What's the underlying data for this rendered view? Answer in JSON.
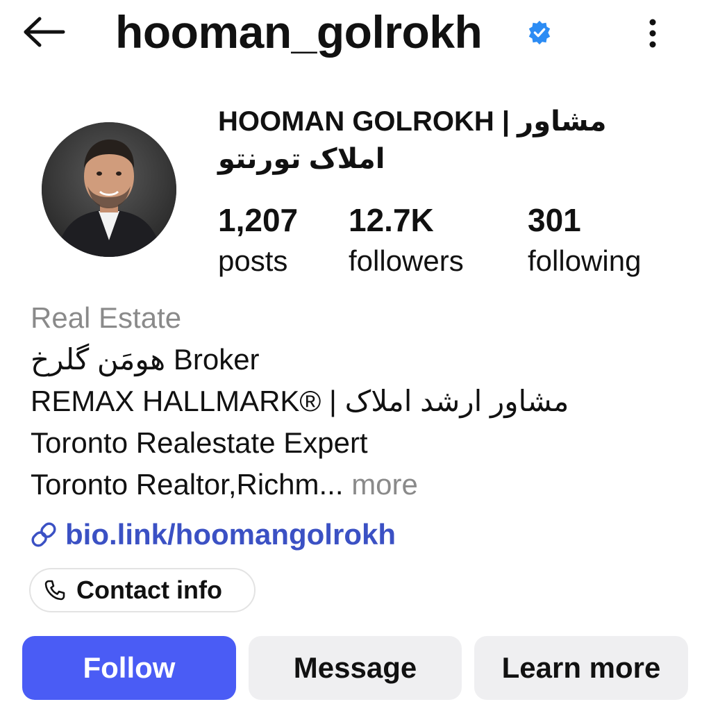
{
  "header": {
    "username": "hooman_golrokh",
    "back_icon": "arrow-left-icon",
    "verified_icon": "verified-badge-icon",
    "more_icon": "more-vertical-icon",
    "verified_color": "#2c8cf4"
  },
  "profile": {
    "avatar_icon": "profile-photo",
    "full_name_line1": "HOOMAN GOLROKH | مشاور",
    "full_name_line2": "املاک تورنتو"
  },
  "stats": {
    "posts": {
      "value": "1,207",
      "label": "posts"
    },
    "followers": {
      "value": "12.7K",
      "label": "followers"
    },
    "following": {
      "value": "301",
      "label": "following"
    }
  },
  "bio": {
    "category": "Real Estate",
    "line1": "هومَن گلرخ  Broker",
    "line2": "REMAX HALLMARK® | مشاور ارشد املاک",
    "line3": "Toronto Realestate Expert",
    "line4": "Toronto Realtor,Richm...",
    "more_label": "more",
    "link_icon": "link-icon",
    "link_text": "bio.link/hoomangolrokh",
    "link_color": "#3b51c4"
  },
  "contact": {
    "icon": "phone-icon",
    "label": "Contact info"
  },
  "actions": {
    "follow_label": "Follow",
    "message_label": "Message",
    "learn_more_label": "Learn more",
    "follow_color": "#4a5cf5"
  }
}
